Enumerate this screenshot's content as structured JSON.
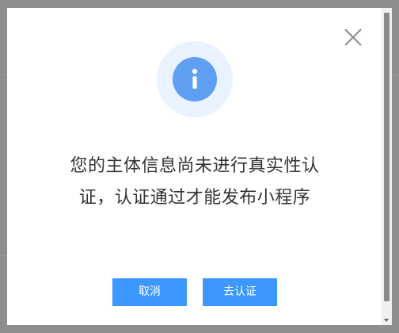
{
  "dialog": {
    "message": "您的主体信息尚未进行真实性认证，认证通过才能发布小程序",
    "cancel_label": "取消",
    "confirm_label": "去认证",
    "icon": "info-icon",
    "close_icon": "close-icon"
  },
  "colors": {
    "accent": "#3c98ff",
    "info_circle": "#5f9ff2",
    "info_halo": "#e9f3ff",
    "overlay": "#8e8e8e"
  }
}
